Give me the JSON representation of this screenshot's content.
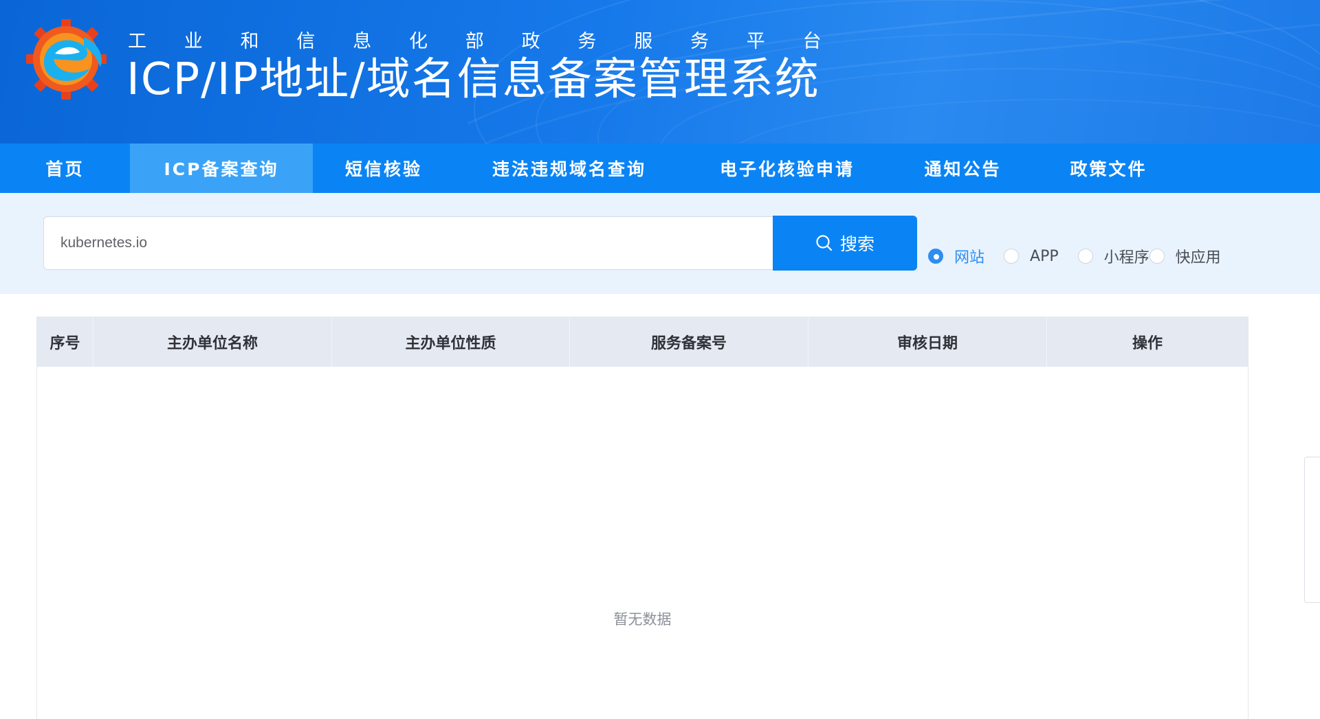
{
  "header": {
    "subtitle_chars": [
      "工",
      "业",
      "和",
      "信",
      "息",
      "化",
      "部",
      "政",
      "务",
      "服",
      "务",
      "平",
      "台"
    ],
    "title": "ICP/IP地址/域名信息备案管理系统",
    "logo_icon": "e-gear-logo-icon"
  },
  "nav": {
    "items": [
      {
        "label": "首页",
        "active": false
      },
      {
        "label": "ICP备案查询",
        "active": true
      },
      {
        "label": "短信核验",
        "active": false
      },
      {
        "label": "违法违规域名查询",
        "active": false
      },
      {
        "label": "电子化核验申请",
        "active": false
      },
      {
        "label": "通知公告",
        "active": false
      },
      {
        "label": "政策文件",
        "active": false
      }
    ]
  },
  "search": {
    "value": "kubernetes.io",
    "button_label": "搜索",
    "button_icon": "search-icon",
    "types": [
      {
        "label": "网站",
        "checked": true
      },
      {
        "label": "APP",
        "checked": false
      },
      {
        "label": "小程序",
        "checked": false
      },
      {
        "label": "快应用",
        "checked": false
      }
    ]
  },
  "table": {
    "columns": [
      "序号",
      "主办单位名称",
      "主办单位性质",
      "服务备案号",
      "审核日期",
      "操作"
    ],
    "rows": [],
    "empty_text": "暂无数据"
  },
  "colors": {
    "nav_bg": "#0a84f5",
    "nav_active": "#3aa3f7",
    "search_band": "#e9f3fd",
    "radio_checked": "#2e8df0"
  }
}
